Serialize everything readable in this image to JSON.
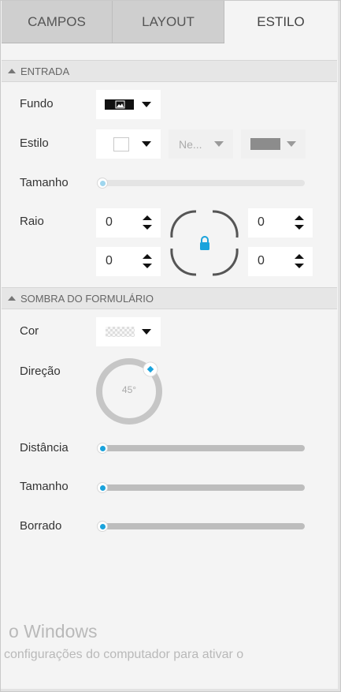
{
  "tabs": [
    {
      "label": "CAMPOS",
      "active": false
    },
    {
      "label": "LAYOUT",
      "active": false
    },
    {
      "label": "ESTILO",
      "active": true
    }
  ],
  "entrada": {
    "header": "ENTRADA",
    "fundo_label": "Fundo",
    "estilo_label": "Estilo",
    "estilo_type_value": "Ne...",
    "tamanho_label": "Tamanho",
    "tamanho_value": 0,
    "raio_label": "Raio",
    "raio": {
      "top_left": "0",
      "top_right": "0",
      "bottom_left": "0",
      "bottom_right": "0",
      "locked": true
    }
  },
  "sombra": {
    "header": "SOMBRA DO FORMULÁRIO",
    "cor_label": "Cor",
    "direcao_label": "Direção",
    "direcao_value": "45°",
    "distancia_label": "Distância",
    "distancia_value": 0,
    "tamanho_label": "Tamanho",
    "tamanho_value": 0,
    "borrado_label": "Borrado",
    "borrado_value": 0
  },
  "watermark": {
    "line1": "o Windows",
    "line2": "configurações do computador para ativar o"
  },
  "colors": {
    "accent": "#1aa3dc",
    "border_color_swatch": "#8c8c8c",
    "tab_bg": "#cfcfcf",
    "panel_bg": "#f4f4f4"
  },
  "icons": [
    "image-icon",
    "lock-icon",
    "caret-up-icon",
    "chevron-down-icon",
    "spinner-up-icon",
    "spinner-down-icon"
  ]
}
